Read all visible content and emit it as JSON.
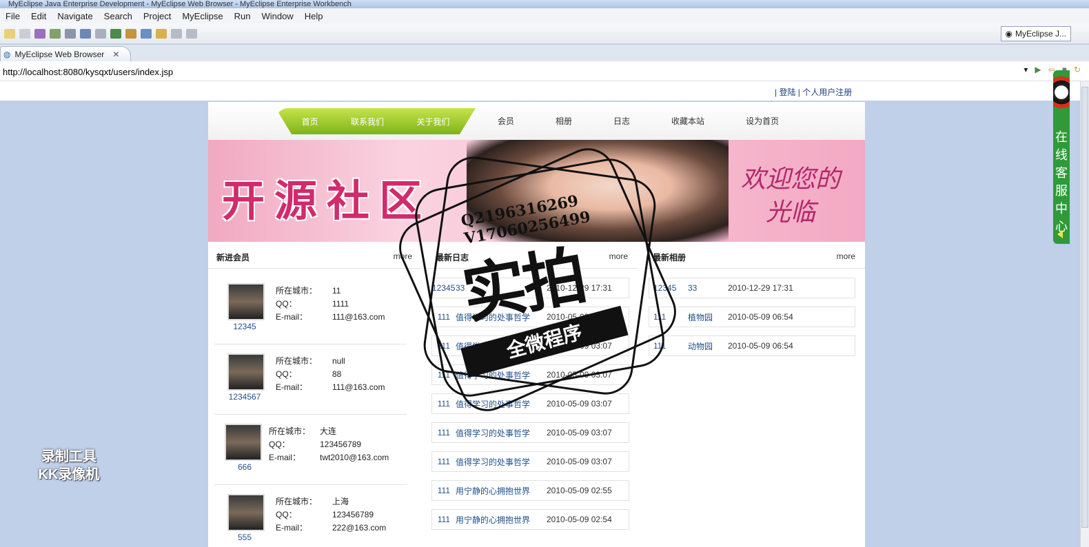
{
  "window": {
    "title": "MyEclipse Java Enterprise Development - MyEclipse Web Browser - MyEclipse Enterprise Workbench"
  },
  "menu": [
    "File",
    "Edit",
    "Navigate",
    "Search",
    "Project",
    "MyEclipse",
    "Run",
    "Window",
    "Help"
  ],
  "perspective": {
    "label": "MyEclipse J..."
  },
  "tab": {
    "label": "MyEclipse Web Browser"
  },
  "address": {
    "url": "http://localhost:8080/kysqxt/users/index.jsp"
  },
  "site": {
    "top_links": "| 登陆 | 个人用户注册",
    "green_nav": [
      "首页",
      "联系我们",
      "关于我们"
    ],
    "right_nav": [
      "会员",
      "相册",
      "日志",
      "收藏本站",
      "设为首页"
    ],
    "banner_title": "开源社区",
    "banner_right": "欢迎您的光临",
    "members_section": {
      "title": "新进会员",
      "more": "more"
    },
    "members": [
      {
        "name": "12345",
        "city_label": "所在城市：",
        "city": "11",
        "qq_label": "QQ：",
        "qq": "1111",
        "email_label": "E-mail：",
        "email": "111@163.com"
      },
      {
        "name": "1234567",
        "city_label": "所在城市：",
        "city": "null",
        "qq_label": "QQ：",
        "qq": "88",
        "email_label": "E-mail：",
        "email": "111@163.com"
      },
      {
        "name": "666",
        "city_label": "所在城市：",
        "city": "大连",
        "qq_label": "QQ：",
        "qq": "123456789",
        "email_label": "E-mail：",
        "email": "twt2010@163.com"
      },
      {
        "name": "555",
        "city_label": "所在城市：",
        "city": "上海",
        "qq_label": "QQ：",
        "qq": "123456789",
        "email_label": "E-mail：",
        "email": "222@163.com"
      }
    ],
    "diary_section": {
      "title": "最新日志",
      "more": "more"
    },
    "diaries": [
      {
        "user": "12345",
        "title": "33",
        "time": "2010-12-29 17:31"
      },
      {
        "user": "111",
        "title": "值得学习的处事哲学",
        "time": "2010-05-09 03:07"
      },
      {
        "user": "111",
        "title": "值得学习的处事哲学",
        "time": "2010-05-09 03:07"
      },
      {
        "user": "111",
        "title": "值得学习的处事哲学",
        "time": "2010-05-09 03:07"
      },
      {
        "user": "111",
        "title": "值得学习的处事哲学",
        "time": "2010-05-09 03:07"
      },
      {
        "user": "111",
        "title": "值得学习的处事哲学",
        "time": "2010-05-09 03:07"
      },
      {
        "user": "111",
        "title": "值得学习的处事哲学",
        "time": "2010-05-09 03:07"
      },
      {
        "user": "111",
        "title": "用宁静的心拥抱世界",
        "time": "2010-05-09 02:55"
      },
      {
        "user": "111",
        "title": "用宁静的心拥抱世界",
        "time": "2010-05-09 02:54"
      }
    ],
    "album_section": {
      "title": "最新相册",
      "more": "more"
    },
    "albums": [
      {
        "user": "12345",
        "title": "33",
        "time": "2010-12-29 17:31"
      },
      {
        "user": "111",
        "title": "植物园",
        "time": "2010-05-09 06:54"
      },
      {
        "user": "111",
        "title": "动物园",
        "time": "2010-05-09 06:54"
      }
    ]
  },
  "service_widget": {
    "text": "在线客服中心"
  },
  "watermark": {
    "q": "Q2196316269",
    "v": "V17060256499",
    "big": "实拍",
    "band": "全微程序"
  },
  "recorder": {
    "line1": "录制工具",
    "line2": "KK录像机"
  }
}
